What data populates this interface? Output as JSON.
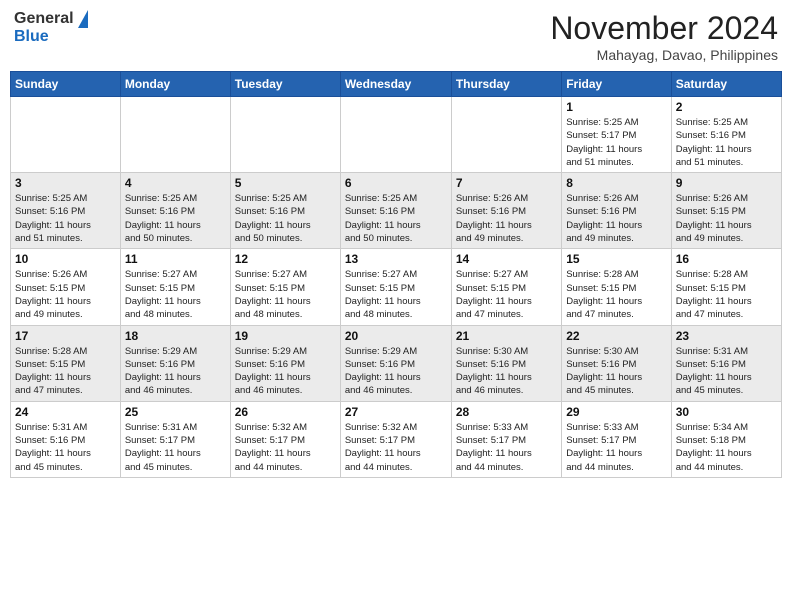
{
  "header": {
    "logo_general": "General",
    "logo_blue": "Blue",
    "month_year": "November 2024",
    "location": "Mahayag, Davao, Philippines"
  },
  "days_of_week": [
    "Sunday",
    "Monday",
    "Tuesday",
    "Wednesday",
    "Thursday",
    "Friday",
    "Saturday"
  ],
  "weeks": [
    [
      {
        "day": "",
        "info": ""
      },
      {
        "day": "",
        "info": ""
      },
      {
        "day": "",
        "info": ""
      },
      {
        "day": "",
        "info": ""
      },
      {
        "day": "",
        "info": ""
      },
      {
        "day": "1",
        "info": "Sunrise: 5:25 AM\nSunset: 5:17 PM\nDaylight: 11 hours\nand 51 minutes."
      },
      {
        "day": "2",
        "info": "Sunrise: 5:25 AM\nSunset: 5:16 PM\nDaylight: 11 hours\nand 51 minutes."
      }
    ],
    [
      {
        "day": "3",
        "info": "Sunrise: 5:25 AM\nSunset: 5:16 PM\nDaylight: 11 hours\nand 51 minutes."
      },
      {
        "day": "4",
        "info": "Sunrise: 5:25 AM\nSunset: 5:16 PM\nDaylight: 11 hours\nand 50 minutes."
      },
      {
        "day": "5",
        "info": "Sunrise: 5:25 AM\nSunset: 5:16 PM\nDaylight: 11 hours\nand 50 minutes."
      },
      {
        "day": "6",
        "info": "Sunrise: 5:25 AM\nSunset: 5:16 PM\nDaylight: 11 hours\nand 50 minutes."
      },
      {
        "day": "7",
        "info": "Sunrise: 5:26 AM\nSunset: 5:16 PM\nDaylight: 11 hours\nand 49 minutes."
      },
      {
        "day": "8",
        "info": "Sunrise: 5:26 AM\nSunset: 5:16 PM\nDaylight: 11 hours\nand 49 minutes."
      },
      {
        "day": "9",
        "info": "Sunrise: 5:26 AM\nSunset: 5:15 PM\nDaylight: 11 hours\nand 49 minutes."
      }
    ],
    [
      {
        "day": "10",
        "info": "Sunrise: 5:26 AM\nSunset: 5:15 PM\nDaylight: 11 hours\nand 49 minutes."
      },
      {
        "day": "11",
        "info": "Sunrise: 5:27 AM\nSunset: 5:15 PM\nDaylight: 11 hours\nand 48 minutes."
      },
      {
        "day": "12",
        "info": "Sunrise: 5:27 AM\nSunset: 5:15 PM\nDaylight: 11 hours\nand 48 minutes."
      },
      {
        "day": "13",
        "info": "Sunrise: 5:27 AM\nSunset: 5:15 PM\nDaylight: 11 hours\nand 48 minutes."
      },
      {
        "day": "14",
        "info": "Sunrise: 5:27 AM\nSunset: 5:15 PM\nDaylight: 11 hours\nand 47 minutes."
      },
      {
        "day": "15",
        "info": "Sunrise: 5:28 AM\nSunset: 5:15 PM\nDaylight: 11 hours\nand 47 minutes."
      },
      {
        "day": "16",
        "info": "Sunrise: 5:28 AM\nSunset: 5:15 PM\nDaylight: 11 hours\nand 47 minutes."
      }
    ],
    [
      {
        "day": "17",
        "info": "Sunrise: 5:28 AM\nSunset: 5:15 PM\nDaylight: 11 hours\nand 47 minutes."
      },
      {
        "day": "18",
        "info": "Sunrise: 5:29 AM\nSunset: 5:16 PM\nDaylight: 11 hours\nand 46 minutes."
      },
      {
        "day": "19",
        "info": "Sunrise: 5:29 AM\nSunset: 5:16 PM\nDaylight: 11 hours\nand 46 minutes."
      },
      {
        "day": "20",
        "info": "Sunrise: 5:29 AM\nSunset: 5:16 PM\nDaylight: 11 hours\nand 46 minutes."
      },
      {
        "day": "21",
        "info": "Sunrise: 5:30 AM\nSunset: 5:16 PM\nDaylight: 11 hours\nand 46 minutes."
      },
      {
        "day": "22",
        "info": "Sunrise: 5:30 AM\nSunset: 5:16 PM\nDaylight: 11 hours\nand 45 minutes."
      },
      {
        "day": "23",
        "info": "Sunrise: 5:31 AM\nSunset: 5:16 PM\nDaylight: 11 hours\nand 45 minutes."
      }
    ],
    [
      {
        "day": "24",
        "info": "Sunrise: 5:31 AM\nSunset: 5:16 PM\nDaylight: 11 hours\nand 45 minutes."
      },
      {
        "day": "25",
        "info": "Sunrise: 5:31 AM\nSunset: 5:17 PM\nDaylight: 11 hours\nand 45 minutes."
      },
      {
        "day": "26",
        "info": "Sunrise: 5:32 AM\nSunset: 5:17 PM\nDaylight: 11 hours\nand 44 minutes."
      },
      {
        "day": "27",
        "info": "Sunrise: 5:32 AM\nSunset: 5:17 PM\nDaylight: 11 hours\nand 44 minutes."
      },
      {
        "day": "28",
        "info": "Sunrise: 5:33 AM\nSunset: 5:17 PM\nDaylight: 11 hours\nand 44 minutes."
      },
      {
        "day": "29",
        "info": "Sunrise: 5:33 AM\nSunset: 5:17 PM\nDaylight: 11 hours\nand 44 minutes."
      },
      {
        "day": "30",
        "info": "Sunrise: 5:34 AM\nSunset: 5:18 PM\nDaylight: 11 hours\nand 44 minutes."
      }
    ]
  ]
}
